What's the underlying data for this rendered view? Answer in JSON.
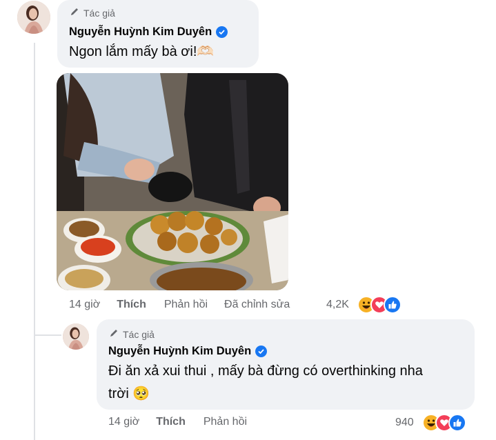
{
  "comment": {
    "author_tag": "Tác giả",
    "author_name": "Nguyễn Huỳnh Kim Duyên",
    "text": "Ngon lắm mấy bà ơi!🫶🏻",
    "time": "14 giờ",
    "like_label": "Thích",
    "reply_label": "Phản hồi",
    "edited_label": "Đã chỉnh sửa",
    "reaction_count": "4,2K",
    "reactions": [
      "haha-icon",
      "love-icon",
      "like-icon"
    ]
  },
  "reply": {
    "author_tag": "Tác giả",
    "author_name": "Nguyễn Huỳnh Kim Duyên",
    "text_line1": "Đi ăn xả xui thui , mấy bà đừng có overthinking nha",
    "text_line2": "trời 🥺",
    "time": "14 giờ",
    "like_label": "Thích",
    "reply_label": "Phản hồi",
    "reaction_count": "940",
    "reactions": [
      "haha-icon",
      "love-icon",
      "like-icon"
    ]
  },
  "colors": {
    "verified": "#1877f2",
    "bubble": "#f0f2f5",
    "meta_text": "#65676b",
    "haha": "#f7b125",
    "love": "#f33e58",
    "like": "#1877f2"
  }
}
